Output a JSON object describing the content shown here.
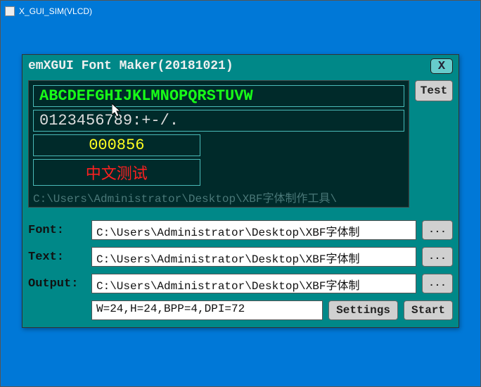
{
  "window": {
    "title": "X_GUI_SIM(VLCD)"
  },
  "app": {
    "title": "emXGUI Font Maker(20181021)",
    "close_label": "X"
  },
  "preview": {
    "sample_alpha": "ABCDEFGHIJKLMNOPQRSTUVW",
    "sample_digits": "0123456789:+-/.",
    "sample_number": "000856",
    "sample_cjk": "中文测试",
    "bottom_path": "C:\\Users\\Administrator\\Desktop\\XBF字体制作工具\\"
  },
  "buttons": {
    "test": "Test",
    "browse": "...",
    "settings": "Settings",
    "start": "Start"
  },
  "form": {
    "font_label": "Font:",
    "font_value": "C:\\Users\\Administrator\\Desktop\\XBF字体制",
    "text_label": "Text:",
    "text_value": "C:\\Users\\Administrator\\Desktop\\XBF字体制",
    "output_label": "Output:",
    "output_value": "C:\\Users\\Administrator\\Desktop\\XBF字体制",
    "params_value": "W=24,H=24,BPP=4,DPI=72"
  }
}
